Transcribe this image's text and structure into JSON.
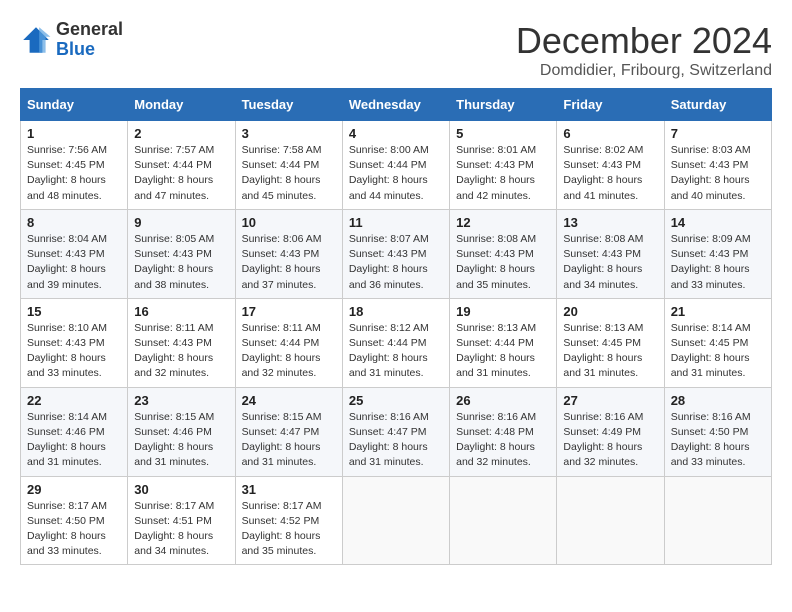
{
  "header": {
    "logo_line1": "General",
    "logo_line2": "Blue",
    "month": "December 2024",
    "location": "Domdidier, Fribourg, Switzerland"
  },
  "weekdays": [
    "Sunday",
    "Monday",
    "Tuesday",
    "Wednesday",
    "Thursday",
    "Friday",
    "Saturday"
  ],
  "weeks": [
    [
      {
        "day": "1",
        "info": "Sunrise: 7:56 AM\nSunset: 4:45 PM\nDaylight: 8 hours\nand 48 minutes."
      },
      {
        "day": "2",
        "info": "Sunrise: 7:57 AM\nSunset: 4:44 PM\nDaylight: 8 hours\nand 47 minutes."
      },
      {
        "day": "3",
        "info": "Sunrise: 7:58 AM\nSunset: 4:44 PM\nDaylight: 8 hours\nand 45 minutes."
      },
      {
        "day": "4",
        "info": "Sunrise: 8:00 AM\nSunset: 4:44 PM\nDaylight: 8 hours\nand 44 minutes."
      },
      {
        "day": "5",
        "info": "Sunrise: 8:01 AM\nSunset: 4:43 PM\nDaylight: 8 hours\nand 42 minutes."
      },
      {
        "day": "6",
        "info": "Sunrise: 8:02 AM\nSunset: 4:43 PM\nDaylight: 8 hours\nand 41 minutes."
      },
      {
        "day": "7",
        "info": "Sunrise: 8:03 AM\nSunset: 4:43 PM\nDaylight: 8 hours\nand 40 minutes."
      }
    ],
    [
      {
        "day": "8",
        "info": "Sunrise: 8:04 AM\nSunset: 4:43 PM\nDaylight: 8 hours\nand 39 minutes."
      },
      {
        "day": "9",
        "info": "Sunrise: 8:05 AM\nSunset: 4:43 PM\nDaylight: 8 hours\nand 38 minutes."
      },
      {
        "day": "10",
        "info": "Sunrise: 8:06 AM\nSunset: 4:43 PM\nDaylight: 8 hours\nand 37 minutes."
      },
      {
        "day": "11",
        "info": "Sunrise: 8:07 AM\nSunset: 4:43 PM\nDaylight: 8 hours\nand 36 minutes."
      },
      {
        "day": "12",
        "info": "Sunrise: 8:08 AM\nSunset: 4:43 PM\nDaylight: 8 hours\nand 35 minutes."
      },
      {
        "day": "13",
        "info": "Sunrise: 8:08 AM\nSunset: 4:43 PM\nDaylight: 8 hours\nand 34 minutes."
      },
      {
        "day": "14",
        "info": "Sunrise: 8:09 AM\nSunset: 4:43 PM\nDaylight: 8 hours\nand 33 minutes."
      }
    ],
    [
      {
        "day": "15",
        "info": "Sunrise: 8:10 AM\nSunset: 4:43 PM\nDaylight: 8 hours\nand 33 minutes."
      },
      {
        "day": "16",
        "info": "Sunrise: 8:11 AM\nSunset: 4:43 PM\nDaylight: 8 hours\nand 32 minutes."
      },
      {
        "day": "17",
        "info": "Sunrise: 8:11 AM\nSunset: 4:44 PM\nDaylight: 8 hours\nand 32 minutes."
      },
      {
        "day": "18",
        "info": "Sunrise: 8:12 AM\nSunset: 4:44 PM\nDaylight: 8 hours\nand 31 minutes."
      },
      {
        "day": "19",
        "info": "Sunrise: 8:13 AM\nSunset: 4:44 PM\nDaylight: 8 hours\nand 31 minutes."
      },
      {
        "day": "20",
        "info": "Sunrise: 8:13 AM\nSunset: 4:45 PM\nDaylight: 8 hours\nand 31 minutes."
      },
      {
        "day": "21",
        "info": "Sunrise: 8:14 AM\nSunset: 4:45 PM\nDaylight: 8 hours\nand 31 minutes."
      }
    ],
    [
      {
        "day": "22",
        "info": "Sunrise: 8:14 AM\nSunset: 4:46 PM\nDaylight: 8 hours\nand 31 minutes."
      },
      {
        "day": "23",
        "info": "Sunrise: 8:15 AM\nSunset: 4:46 PM\nDaylight: 8 hours\nand 31 minutes."
      },
      {
        "day": "24",
        "info": "Sunrise: 8:15 AM\nSunset: 4:47 PM\nDaylight: 8 hours\nand 31 minutes."
      },
      {
        "day": "25",
        "info": "Sunrise: 8:16 AM\nSunset: 4:47 PM\nDaylight: 8 hours\nand 31 minutes."
      },
      {
        "day": "26",
        "info": "Sunrise: 8:16 AM\nSunset: 4:48 PM\nDaylight: 8 hours\nand 32 minutes."
      },
      {
        "day": "27",
        "info": "Sunrise: 8:16 AM\nSunset: 4:49 PM\nDaylight: 8 hours\nand 32 minutes."
      },
      {
        "day": "28",
        "info": "Sunrise: 8:16 AM\nSunset: 4:50 PM\nDaylight: 8 hours\nand 33 minutes."
      }
    ],
    [
      {
        "day": "29",
        "info": "Sunrise: 8:17 AM\nSunset: 4:50 PM\nDaylight: 8 hours\nand 33 minutes."
      },
      {
        "day": "30",
        "info": "Sunrise: 8:17 AM\nSunset: 4:51 PM\nDaylight: 8 hours\nand 34 minutes."
      },
      {
        "day": "31",
        "info": "Sunrise: 8:17 AM\nSunset: 4:52 PM\nDaylight: 8 hours\nand 35 minutes."
      },
      {
        "day": "",
        "info": ""
      },
      {
        "day": "",
        "info": ""
      },
      {
        "day": "",
        "info": ""
      },
      {
        "day": "",
        "info": ""
      }
    ]
  ]
}
